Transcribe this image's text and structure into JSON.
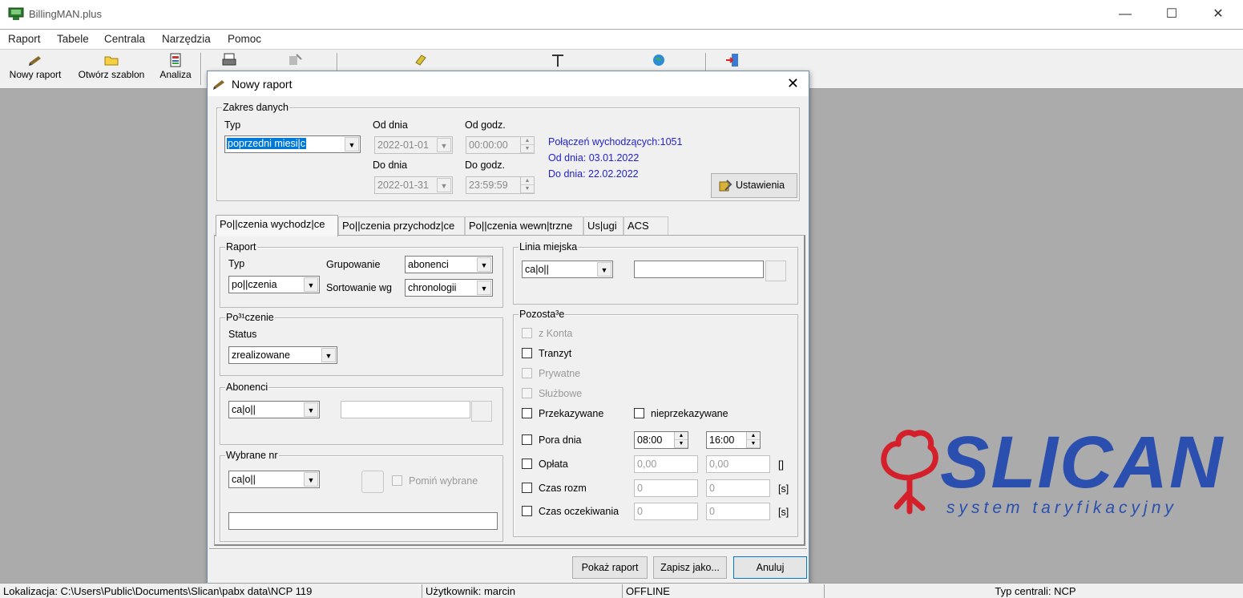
{
  "window": {
    "title": "BillingMAN.plus"
  },
  "menu": [
    "Raport",
    "Tabele",
    "Centrala",
    "Narzędzia",
    "Pomoc"
  ],
  "toolbar": {
    "new_report": "Nowy raport",
    "open_template": "Otwórz szablon",
    "analysis": "Analiza"
  },
  "status": {
    "location": "Lokalizacja: C:\\Users\\Public\\Documents\\Slican\\pabx data\\NCP 119",
    "user": "Użytkownik: marcin",
    "mode": "OFFLINE",
    "pbx_type": "Typ centrali: NCP"
  },
  "logo": {
    "word": "SLICAN",
    "tagline": "system taryfikacyjny",
    "color": "#2a4fae"
  },
  "dialog": {
    "title": "Nowy raport",
    "range": {
      "legend": "Zakres danych",
      "type_label": "Typ",
      "type_value": "poprzedni miesi|c",
      "from_day_label": "Od dnia",
      "from_day_value": "2022-01-01",
      "from_hour_label": "Od godz.",
      "from_hour_value": "00:00:00",
      "to_day_label": "Do dnia",
      "to_day_value": "2022-01-31",
      "to_hour_label": "Do godz.",
      "to_hour_value": "23:59:59",
      "info_count": "Połączeń wychodzących:1051",
      "info_from": "Od dnia: 03.01.2022",
      "info_to": "Do dnia:  22.02.2022",
      "settings_button": "Ustawienia"
    },
    "tabs": [
      "Po||czenia wychodz|ce",
      "Po||czenia przychodz|ce",
      "Po||czenia wewn|trzne",
      "Us|ugi",
      "ACS"
    ],
    "report": {
      "legend": "Raport",
      "type_label": "Typ",
      "type_value": "po||czenia",
      "group_label": "Grupowanie",
      "group_value": "abonenci",
      "sort_label": "Sortowanie wg",
      "sort_value": "chronologii"
    },
    "connection": {
      "legend": "Po³¹czenie",
      "status_label": "Status",
      "status_value": "zrealizowane"
    },
    "subscribers": {
      "legend": "Abonenci",
      "value": "ca|o||",
      "text": ""
    },
    "selected": {
      "legend": "Wybrane nr",
      "value": "ca|o||",
      "skip_label": "Pomiń wybrane",
      "text": ""
    },
    "city_line": {
      "legend": "Linia miejska",
      "value": "ca|o||",
      "text": ""
    },
    "other": {
      "legend": "Pozosta³e",
      "from_account": "z Konta",
      "transit": "Tranzyt",
      "private": "Prywatne",
      "business": "Służbowe",
      "forwarded": "Przekazywane",
      "not_forwarded": "nieprzekazywane",
      "time_of_day": "Pora dnia",
      "time_from": "08:00",
      "time_to": "16:00",
      "fee": "Opłata",
      "fee_from": "0,00",
      "fee_to": "0,00",
      "fee_unit": "[]",
      "duration": "Czas rozm",
      "duration_from": "0",
      "duration_to": "0",
      "duration_unit": "[s]",
      "wait": "Czas oczekiwania",
      "wait_from": "0",
      "wait_to": "0",
      "wait_unit": "[s]"
    },
    "buttons": {
      "show": "Pokaż raport",
      "save_as": "Zapisz jako...",
      "cancel": "Anuluj"
    }
  }
}
